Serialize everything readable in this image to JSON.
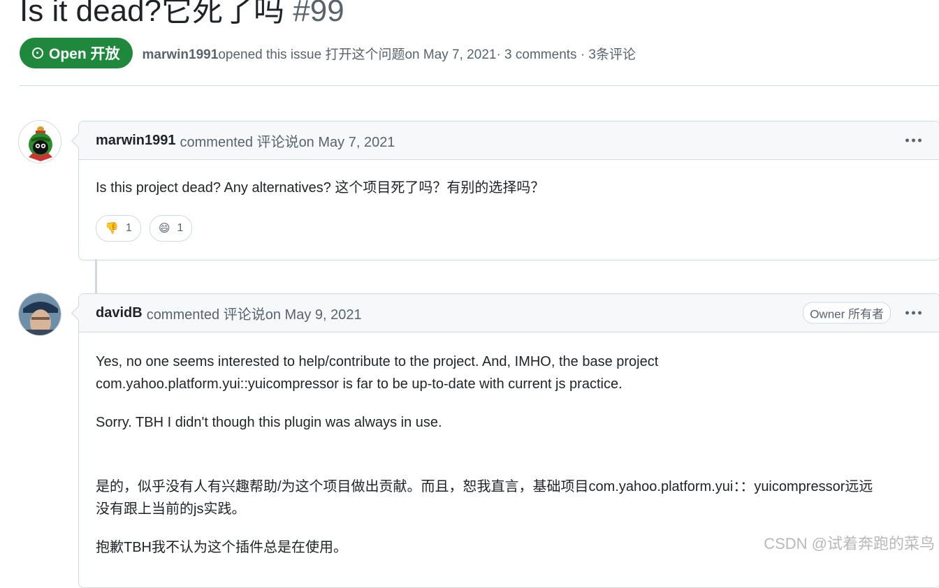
{
  "issue": {
    "title": "Is it dead?它死了吗",
    "number": "#99",
    "state_label": "Open 开放",
    "author": "marwin1991",
    "meta_text": "opened this issue 打开这个问题on May 7, 2021· 3 comments · 3条评论"
  },
  "comments": [
    {
      "author": "marwin1991",
      "action": "commented 评论说on May 7, 2021",
      "body": [
        "Is this project dead? Any alternatives? 这个项目死了吗？有别的选择吗？"
      ],
      "reactions": [
        {
          "icon": "thumbs-down-icon",
          "glyph": "👎",
          "count": "1"
        },
        {
          "icon": "laugh-icon",
          "glyph": "😄",
          "count": "1"
        }
      ]
    },
    {
      "author": "davidB",
      "action": "commented 评论说on May 9, 2021",
      "badge": "Owner 所有者",
      "body": [
        "Yes, no one seems interested to help/contribute to the project. And, IMHO, the base project",
        "com.yahoo.platform.yui::yuicompressor is far to be up-to-date with current js practice.",
        "Sorry. TBH I didn't though this plugin was always in use.",
        "是的，似乎没有人有兴趣帮助/为这个项目做出贡献。而且，恕我直言，基础项目com.yahoo.platform.yui：：yuicompressor远远",
        "没有跟上当前的js实践。",
        "抱歉TBH我不认为这个插件总是在使用。"
      ]
    }
  ],
  "watermark": "CSDN @试着奔跑的菜鸟",
  "colors": {
    "open_green": "#1f883d",
    "muted": "#59636e",
    "border": "#d1d9e0",
    "header_bg": "#f6f8fa"
  }
}
